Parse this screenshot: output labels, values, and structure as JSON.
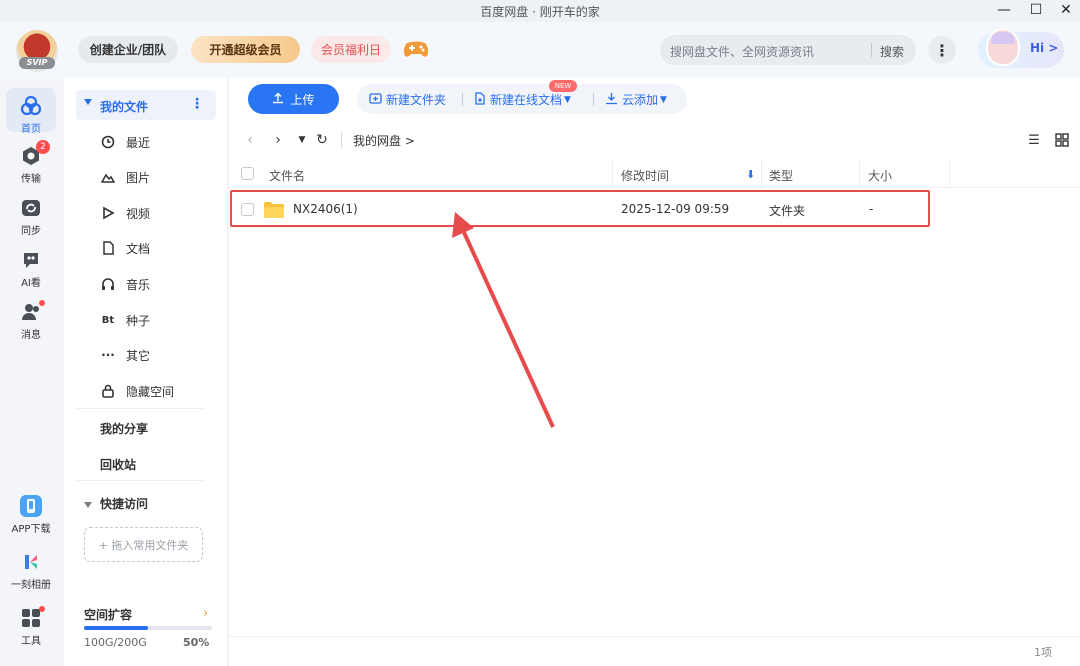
{
  "window": {
    "title": "百度网盘 · 刚开车的家",
    "minimize": "—",
    "maximize": "☐",
    "close": "✕"
  },
  "header": {
    "logo_text": "SVIP",
    "corp_btn": "创建企业/团队",
    "vip_btn": "开通超级会员",
    "welfare_btn": "会员福利日",
    "search_placeholder": "搜网盘文件、全网资源资讯",
    "search_btn": "搜索",
    "hi": "Hi >"
  },
  "rail": {
    "home": "首页",
    "transfer": "传输",
    "transfer_badge": "2",
    "sync": "同步",
    "ai": "AI看",
    "messages": "消息",
    "app_download": "APP下载",
    "album": "一刻相册",
    "tools": "工具"
  },
  "sidebar": {
    "my_files": "我的文件",
    "items": [
      {
        "label": "最近",
        "icon": "clock-icon"
      },
      {
        "label": "图片",
        "icon": "image-icon"
      },
      {
        "label": "视频",
        "icon": "video-icon"
      },
      {
        "label": "文档",
        "icon": "document-icon"
      },
      {
        "label": "音乐",
        "icon": "headphones-icon"
      },
      {
        "label": "种子",
        "icon": "bt-icon"
      },
      {
        "label": "其它",
        "icon": "ellipsis-icon"
      },
      {
        "label": "隐藏空间",
        "icon": "lock-icon"
      }
    ],
    "my_share": "我的分享",
    "recycle": "回收站",
    "quick_access": "快捷访问",
    "drop_hint": "+ 拖入常用文件夹",
    "space_title": "空间扩容",
    "space_used": "100G/200G",
    "space_percent": "50%",
    "space_fraction": 0.5
  },
  "toolbar": {
    "upload": "上传",
    "new_folder": "新建文件夹",
    "new_online_doc": "新建在线文档",
    "new_badge": "NEW",
    "cloud_add": "云添加"
  },
  "breadcrumb": {
    "path": "我的网盘 >"
  },
  "table": {
    "columns": {
      "name": "文件名",
      "modified": "修改时间",
      "type": "类型",
      "size": "大小"
    },
    "rows": [
      {
        "name": "NX2406(1)",
        "modified": "2025-12-09 09:59",
        "type": "文件夹",
        "size": "-"
      }
    ]
  },
  "footer": {
    "count": "1项"
  },
  "colors": {
    "accent": "#2a6ef0",
    "highlight": "#e74c4c"
  }
}
